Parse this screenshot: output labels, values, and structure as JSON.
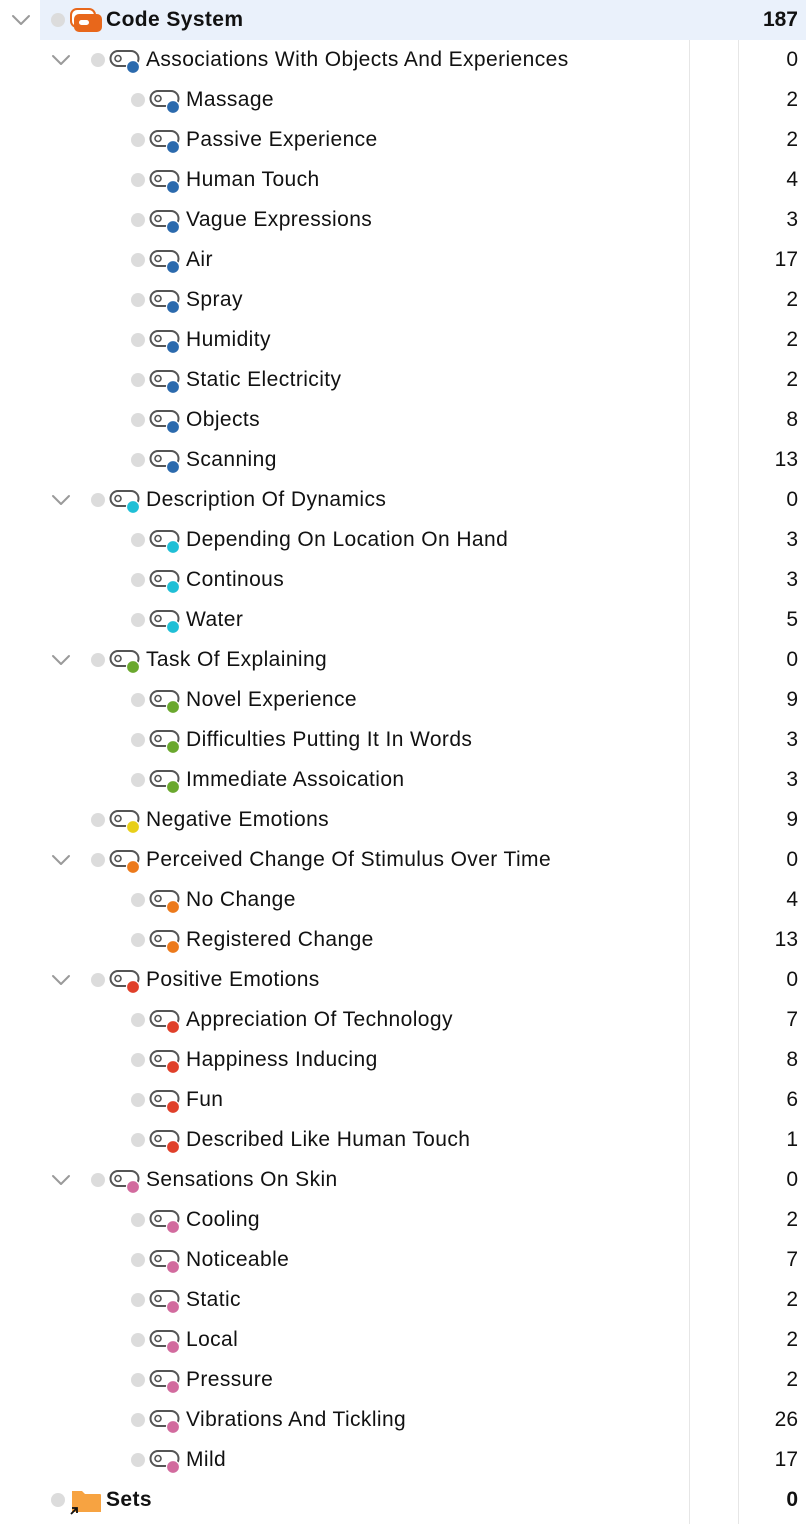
{
  "colors": {
    "blue": "#2b6aad",
    "cyan": "#1fbfd6",
    "green": "#6aa82e",
    "yellow": "#e8cf1a",
    "orange": "#ec7a1c",
    "red": "#e0402a",
    "pink": "#d26b9e",
    "root": "#e8671b",
    "sets": "#f7a341"
  },
  "root": {
    "label": "Code System",
    "count": "187",
    "icon": "code-system-icon"
  },
  "groups": [
    {
      "label": "Associations With Objects And Experiences",
      "count": "0",
      "color": "blue",
      "children": [
        {
          "label": "Massage",
          "count": "2"
        },
        {
          "label": "Passive Experience",
          "count": "2"
        },
        {
          "label": "Human Touch",
          "count": "4"
        },
        {
          "label": "Vague Expressions",
          "count": "3"
        },
        {
          "label": "Air",
          "count": "17"
        },
        {
          "label": "Spray",
          "count": "2"
        },
        {
          "label": "Humidity",
          "count": "2"
        },
        {
          "label": "Static Electricity",
          "count": "2"
        },
        {
          "label": "Objects",
          "count": "8"
        },
        {
          "label": "Scanning",
          "count": "13"
        }
      ]
    },
    {
      "label": "Description Of Dynamics",
      "count": "0",
      "color": "cyan",
      "children": [
        {
          "label": "Depending On Location On Hand",
          "count": "3"
        },
        {
          "label": "Continous",
          "count": "3"
        },
        {
          "label": "Water",
          "count": "5"
        }
      ]
    },
    {
      "label": "Task Of Explaining",
      "count": "0",
      "color": "green",
      "children": [
        {
          "label": "Novel Experience",
          "count": "9"
        },
        {
          "label": "Difficulties Putting It In Words",
          "count": "3"
        },
        {
          "label": "Immediate Assoication",
          "count": "3"
        }
      ]
    },
    {
      "label": "Negative Emotions",
      "count": "9",
      "color": "yellow",
      "children": []
    },
    {
      "label": "Perceived Change Of Stimulus Over Time",
      "count": "0",
      "color": "orange",
      "children": [
        {
          "label": "No Change",
          "count": "4"
        },
        {
          "label": "Registered Change",
          "count": "13"
        }
      ]
    },
    {
      "label": "Positive Emotions",
      "count": "0",
      "color": "red",
      "children": [
        {
          "label": "Appreciation Of Technology",
          "count": "7"
        },
        {
          "label": "Happiness Inducing",
          "count": "8"
        },
        {
          "label": "Fun",
          "count": "6"
        },
        {
          "label": "Described Like Human Touch",
          "count": "1"
        }
      ]
    },
    {
      "label": "Sensations On Skin",
      "count": "0",
      "color": "pink",
      "children": [
        {
          "label": "Cooling",
          "count": "2"
        },
        {
          "label": "Noticeable",
          "count": "7"
        },
        {
          "label": "Static",
          "count": "2"
        },
        {
          "label": "Local",
          "count": "2"
        },
        {
          "label": "Pressure",
          "count": "2"
        },
        {
          "label": "Vibrations And Tickling",
          "count": "26"
        },
        {
          "label": "Mild",
          "count": "17"
        }
      ]
    }
  ],
  "sets": {
    "label": "Sets",
    "count": "0",
    "icon": "folder-shortcut-icon"
  }
}
